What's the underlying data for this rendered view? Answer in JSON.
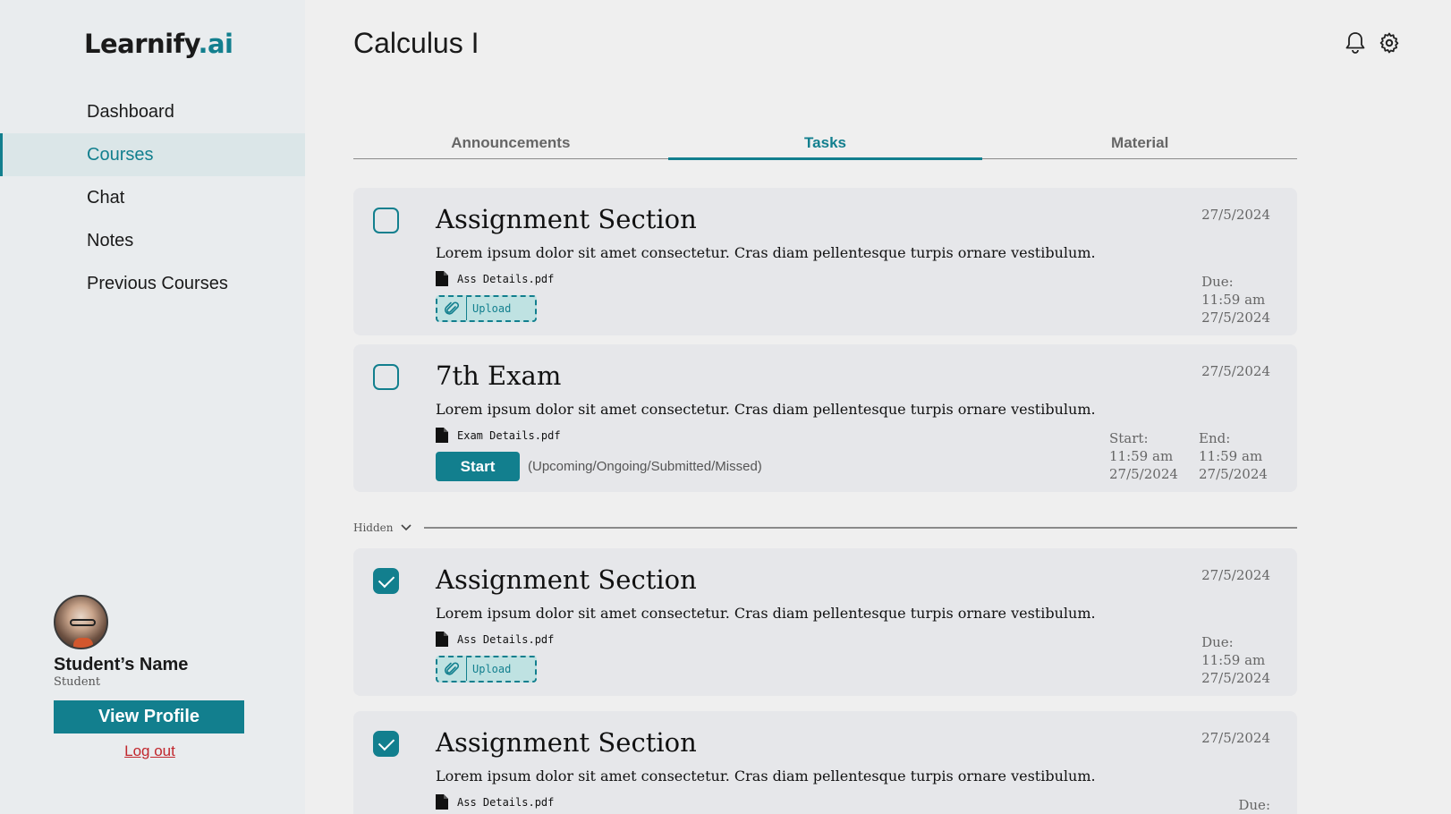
{
  "brand": {
    "name": "Learnify",
    "suffix": ".ai"
  },
  "sidebar": {
    "items": [
      {
        "label": "Dashboard"
      },
      {
        "label": "Courses"
      },
      {
        "label": "Chat"
      },
      {
        "label": "Notes"
      },
      {
        "label": "Previous Courses"
      }
    ],
    "active": "Courses"
  },
  "profile": {
    "name": "Student’s Name",
    "role": "Student",
    "view_profile_label": "View Profile",
    "logout_label": "Log out"
  },
  "header": {
    "title": "Calculus I",
    "icons": [
      "bell-icon",
      "gear-icon"
    ]
  },
  "tabs": [
    {
      "label": "Announcements"
    },
    {
      "label": "Tasks"
    },
    {
      "label": "Material"
    }
  ],
  "active_tab": "Tasks",
  "tasks": [
    {
      "title": "Assignment Section",
      "description": "Lorem ipsum dolor sit amet consectetur. Cras diam pellentesque turpis ornare vestibulum.",
      "file": "Ass Details.pdf",
      "upload_label": "Upload",
      "date": "27/5/2024",
      "due_label": "Due:",
      "due_time": "11:59 am",
      "due_date": "27/5/2024",
      "checked": false
    },
    {
      "title": "7th Exam",
      "description": "Lorem ipsum dolor sit amet consectetur. Cras diam pellentesque turpis ornare vestibulum.",
      "file": "Exam Details.pdf",
      "start_label": "Start",
      "status_text": "(Upcoming/Ongoing/Submitted/Missed)",
      "date": "27/5/2024",
      "start_heading": "Start:",
      "start_time": "11:59 am",
      "start_date": "27/5/2024",
      "end_heading": "End:",
      "end_time": "11:59 am",
      "end_date": "27/5/2024",
      "checked": false
    }
  ],
  "hidden_label": "Hidden",
  "hidden_tasks": [
    {
      "title": "Assignment Section",
      "description": "Lorem ipsum dolor sit amet consectetur. Cras diam pellentesque turpis ornare vestibulum.",
      "file": "Ass Details.pdf",
      "upload_label": "Upload",
      "date": "27/5/2024",
      "due_label": "Due:",
      "due_time": "11:59 am",
      "due_date": "27/5/2024",
      "checked": true
    },
    {
      "title": "Assignment Section",
      "description": "Lorem ipsum dolor sit amet consectetur. Cras diam pellentesque turpis ornare vestibulum.",
      "file": "Ass Details.pdf",
      "date": "27/5/2024",
      "due_label": "Due:",
      "checked": true
    }
  ],
  "colors": {
    "accent": "#127f8e",
    "logout": "#c1272d",
    "card": "#e6e7ea",
    "sidebar": "#e9ecee"
  }
}
